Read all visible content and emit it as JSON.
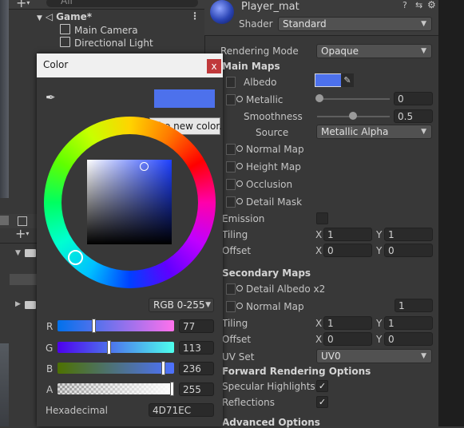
{
  "hierarchy": {
    "search_placeholder": "All",
    "scene_name": "Game*",
    "items": [
      "Main Camera",
      "Directional Light"
    ]
  },
  "inspector": {
    "material_name": "Player_mat",
    "shader_label": "Shader",
    "shader_value": "Standard",
    "rendering_mode_label": "Rendering Mode",
    "rendering_mode_value": "Opaque",
    "main_maps_header": "Main Maps",
    "albedo_label": "Albedo",
    "metallic_label": "Metallic",
    "metallic_value": "0",
    "smoothness_label": "Smoothness",
    "smoothness_value": "0.5",
    "source_label": "Source",
    "source_value": "Metallic Alpha",
    "normal_map_label": "Normal Map",
    "height_map_label": "Height Map",
    "occlusion_label": "Occlusion",
    "detail_mask_label": "Detail Mask",
    "emission_label": "Emission",
    "tiling_label": "Tiling",
    "offset_label": "Offset",
    "x_label": "X",
    "y_label": "Y",
    "main_tiling_x": "1",
    "main_tiling_y": "1",
    "main_offset_x": "0",
    "main_offset_y": "0",
    "secondary_maps_header": "Secondary Maps",
    "detail_albedo_label": "Detail Albedo x2",
    "secondary_normal_label": "Normal Map",
    "secondary_normal_value": "1",
    "sec_tiling_x": "1",
    "sec_tiling_y": "1",
    "sec_offset_x": "0",
    "sec_offset_y": "0",
    "uv_set_label": "UV Set",
    "uv_set_value": "UV0",
    "forward_header": "Forward Rendering Options",
    "specular_label": "Specular Highlights",
    "reflections_label": "Reflections",
    "advanced_header": "Advanced Options",
    "albedo_color": "#4D71EC"
  },
  "color_window": {
    "title": "Color",
    "close_glyph": "x",
    "tooltip": "The new color.",
    "mode_label": "RGB 0-255",
    "channels": [
      {
        "name": "R",
        "value": "77"
      },
      {
        "name": "G",
        "value": "113"
      },
      {
        "name": "B",
        "value": "236"
      },
      {
        "name": "A",
        "value": "255"
      }
    ],
    "channel_levels": [
      0.302,
      0.443,
      0.925,
      1.0
    ],
    "hex_label": "Hexadecimal",
    "hex_value": "4D71EC",
    "swatch_color": "#4D71EC"
  },
  "icons": [
    "plus-icon",
    "eyedropper-icon",
    "kebab-menu-icon",
    "help-icon",
    "settings-icon",
    "sphere-preview-icon"
  ]
}
